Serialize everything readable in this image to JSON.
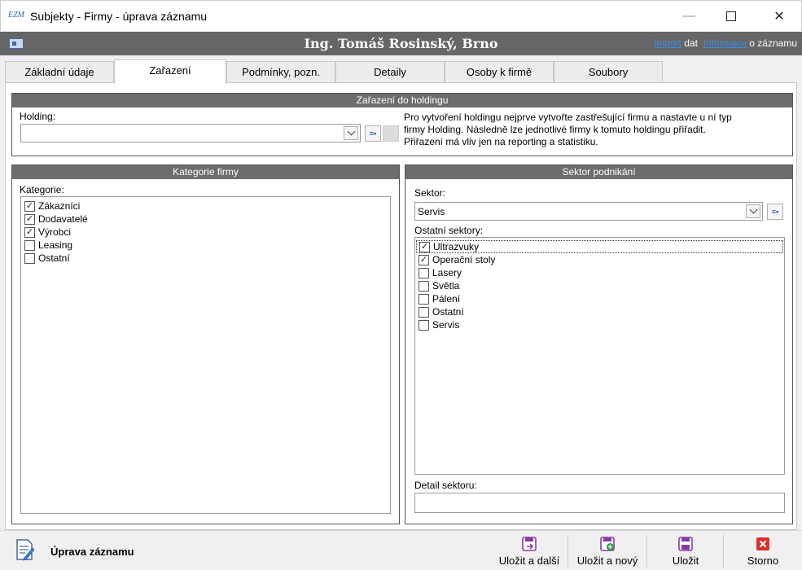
{
  "window": {
    "title": "Subjekty - Firmy - úprava záznamu",
    "app_icon_text": "EZM"
  },
  "header": {
    "person": "Ing. Tomáš Rosinský, Brno",
    "import_link": "Import",
    "import_suffix": "dat",
    "info_link": "Informace",
    "info_suffix": "o záznamu"
  },
  "tabs": [
    {
      "label": "Základní údaje",
      "active": false
    },
    {
      "label": "Zařazení",
      "active": true
    },
    {
      "label": "Podmínky, pozn.",
      "active": false
    },
    {
      "label": "Detaily",
      "active": false
    },
    {
      "label": "Osoby k firmě",
      "active": false
    },
    {
      "label": "Soubory",
      "active": false
    }
  ],
  "holding": {
    "group_title": "Zařazení do holdingu",
    "label": "Holding:",
    "value": "",
    "hint_lines": [
      "Pro vytvoření holdingu nejprve vytvořte zastřešující firmu a nastavte u ní typ",
      "firmy Holding.  Následně lze jednotlivé firmy k tomuto holdingu přiřadit.",
      "Přiřazení má vliv jen na reporting a statistiku."
    ]
  },
  "category": {
    "group_title": "Kategorie firmy",
    "label": "Kategorie:",
    "items": [
      {
        "label": "Zákazníci",
        "checked": true
      },
      {
        "label": "Dodavatelé",
        "checked": true
      },
      {
        "label": "Výrobci",
        "checked": true
      },
      {
        "label": "Leasing",
        "checked": false
      },
      {
        "label": "Ostatní",
        "checked": false
      }
    ]
  },
  "sector": {
    "group_title": "Sektor podnikání",
    "label": "Sektor:",
    "value": "Servis",
    "others_label": "Ostatní sektory:",
    "items": [
      {
        "label": "Ultrazvuky",
        "checked": true,
        "focused": true
      },
      {
        "label": "Operační stoly",
        "checked": true,
        "focused": false
      },
      {
        "label": "Lasery",
        "checked": false,
        "focused": false
      },
      {
        "label": "Světla",
        "checked": false,
        "focused": false
      },
      {
        "label": "Pálení",
        "checked": false,
        "focused": false
      },
      {
        "label": "Ostatní",
        "checked": false,
        "focused": false
      },
      {
        "label": "Servis",
        "checked": false,
        "focused": false
      }
    ],
    "detail_label": "Detail sektoru:",
    "detail_value": ""
  },
  "footer": {
    "mode_label": "Úprava záznamu",
    "buttons": [
      {
        "label": "Uložit a další",
        "icon": "save-next-icon",
        "color": "#8a3aa8"
      },
      {
        "label": "Uložit a nový",
        "icon": "save-new-icon",
        "color": "#8a3aa8"
      },
      {
        "label": "Uložit",
        "icon": "save-icon",
        "color": "#8a3aa8"
      },
      {
        "label": "Storno",
        "icon": "cancel-icon",
        "color": "#d8322a"
      }
    ]
  }
}
